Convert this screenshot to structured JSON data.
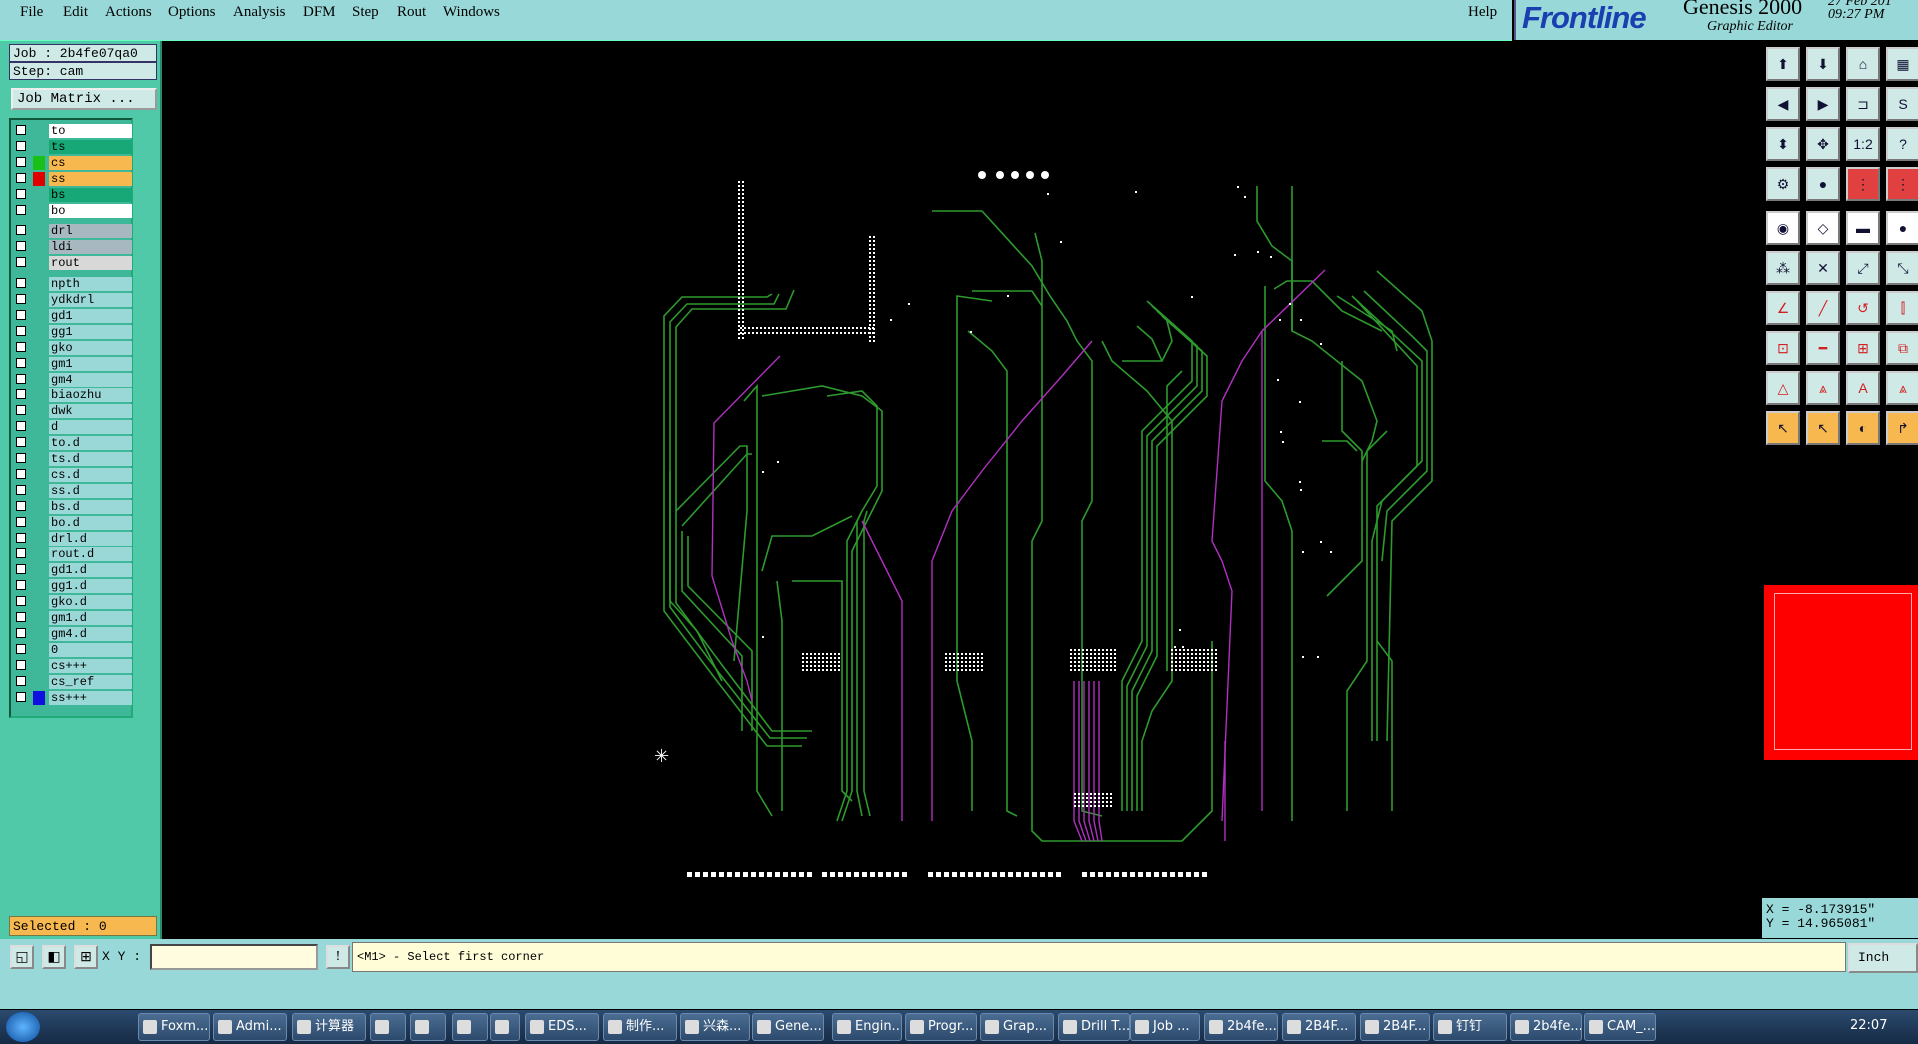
{
  "menu": [
    "File",
    "Edit",
    "Actions",
    "Options",
    "Analysis",
    "DFM",
    "Step",
    "Rout",
    "Windows"
  ],
  "help": "Help",
  "brand": {
    "frontline": "Frontline",
    "genesis": "Genesis 2000",
    "subtitle": "Graphic Editor",
    "date": "27 Feb 201",
    "time": "09:27 PM"
  },
  "job": {
    "job_label": "Job : 2b4fe07qa0",
    "step_label": "Step: cam",
    "matrix_button": "Job Matrix ..."
  },
  "layers": [
    {
      "name": "to",
      "color": "#ffffff",
      "swatch": "",
      "mark": "✎"
    },
    {
      "name": "ts",
      "color": "#18a878",
      "swatch": "",
      "mark": ""
    },
    {
      "name": "cs",
      "color": "#f8b850",
      "swatch": "#18c018",
      "mark": ""
    },
    {
      "name": "ss",
      "color": "#f8b850",
      "swatch": "#e00000",
      "mark": "≡"
    },
    {
      "name": "bs",
      "color": "#18a878",
      "swatch": "",
      "mark": ""
    },
    {
      "name": "bo",
      "color": "#ffffff",
      "swatch": "",
      "mark": "✎"
    },
    {
      "name": "drl",
      "color": "#a8b8c0",
      "swatch": "",
      "mark": ""
    },
    {
      "name": "ldi",
      "color": "#a8b8c0",
      "swatch": "",
      "mark": ""
    },
    {
      "name": "rout",
      "color": "#d8d8d8",
      "swatch": "",
      "mark": ""
    },
    {
      "name": "npth",
      "color": "#9ad8d8",
      "swatch": "",
      "mark": ""
    },
    {
      "name": "ydkdrl",
      "color": "#9ad8d8",
      "swatch": "",
      "mark": ""
    },
    {
      "name": "gd1",
      "color": "#9ad8d8",
      "swatch": "",
      "mark": "✎"
    },
    {
      "name": "gg1",
      "color": "#9ad8d8",
      "swatch": "",
      "mark": ""
    },
    {
      "name": "gko",
      "color": "#9ad8d8",
      "swatch": "",
      "mark": "✎"
    },
    {
      "name": "gm1",
      "color": "#9ad8d8",
      "swatch": "",
      "mark": ""
    },
    {
      "name": "gm4",
      "color": "#9ad8d8",
      "swatch": "",
      "mark": "✎"
    },
    {
      "name": "biaozhu",
      "color": "#9ad8d8",
      "swatch": "",
      "mark": ""
    },
    {
      "name": "dwk",
      "color": "#9ad8d8",
      "swatch": "",
      "mark": ""
    },
    {
      "name": "d",
      "color": "#9ad8d8",
      "swatch": "",
      "mark": ""
    },
    {
      "name": "to.d",
      "color": "#9ad8d8",
      "swatch": "",
      "mark": "✎"
    },
    {
      "name": "ts.d",
      "color": "#9ad8d8",
      "swatch": "",
      "mark": ""
    },
    {
      "name": "cs.d",
      "color": "#9ad8d8",
      "swatch": "",
      "mark": ""
    },
    {
      "name": "ss.d",
      "color": "#9ad8d8",
      "swatch": "",
      "mark": ""
    },
    {
      "name": "bs.d",
      "color": "#9ad8d8",
      "swatch": "",
      "mark": ""
    },
    {
      "name": "bo.d",
      "color": "#9ad8d8",
      "swatch": "",
      "mark": "✎"
    },
    {
      "name": "drl.d",
      "color": "#9ad8d8",
      "swatch": "",
      "mark": ""
    },
    {
      "name": "rout.d",
      "color": "#9ad8d8",
      "swatch": "",
      "mark": ""
    },
    {
      "name": "gd1.d",
      "color": "#9ad8d8",
      "swatch": "",
      "mark": "✎"
    },
    {
      "name": "gg1.d",
      "color": "#9ad8d8",
      "swatch": "",
      "mark": ""
    },
    {
      "name": "gko.d",
      "color": "#9ad8d8",
      "swatch": "",
      "mark": "✎"
    },
    {
      "name": "gm1.d",
      "color": "#9ad8d8",
      "swatch": "",
      "mark": ""
    },
    {
      "name": "gm4.d",
      "color": "#9ad8d8",
      "swatch": "",
      "mark": "✎"
    },
    {
      "name": "0",
      "color": "#9ad8d8",
      "swatch": "",
      "mark": ""
    },
    {
      "name": "cs+++",
      "color": "#9ad8d8",
      "swatch": "",
      "mark": ""
    },
    {
      "name": "cs_ref",
      "color": "#9ad8d8",
      "swatch": "",
      "mark": ""
    },
    {
      "name": "ss+++",
      "color": "#9ad8d8",
      "swatch": "#1010e0",
      "mark": ""
    }
  ],
  "selected": "Selected : 0",
  "coords": {
    "x": "X = -8.173915\"",
    "y": "Y = 14.965081\""
  },
  "xy_label": "X Y :",
  "xy_value": "",
  "message": "<M1> - Select first corner",
  "unit": "Inch",
  "taskbar": [
    "Foxm...",
    "Admi...",
    "计算器",
    "",
    "",
    "",
    "",
    "EDS...",
    "制作...",
    "兴森...",
    "Gene...",
    "Engin...",
    "Progr...",
    "Grap...",
    "Drill T...",
    "Job ...",
    "2b4fe...",
    "2B4F...",
    "2B4F...",
    "钉钉",
    "2b4fe...",
    "CAM_..."
  ],
  "clock": "22:07",
  "colors": {
    "trace_green": "#2e9a2e",
    "trace_magenta": "#b030c0",
    "pad_white": "#ffffff",
    "panel_teal": "#4fc9a8",
    "menu_bg": "#99d8d8"
  }
}
